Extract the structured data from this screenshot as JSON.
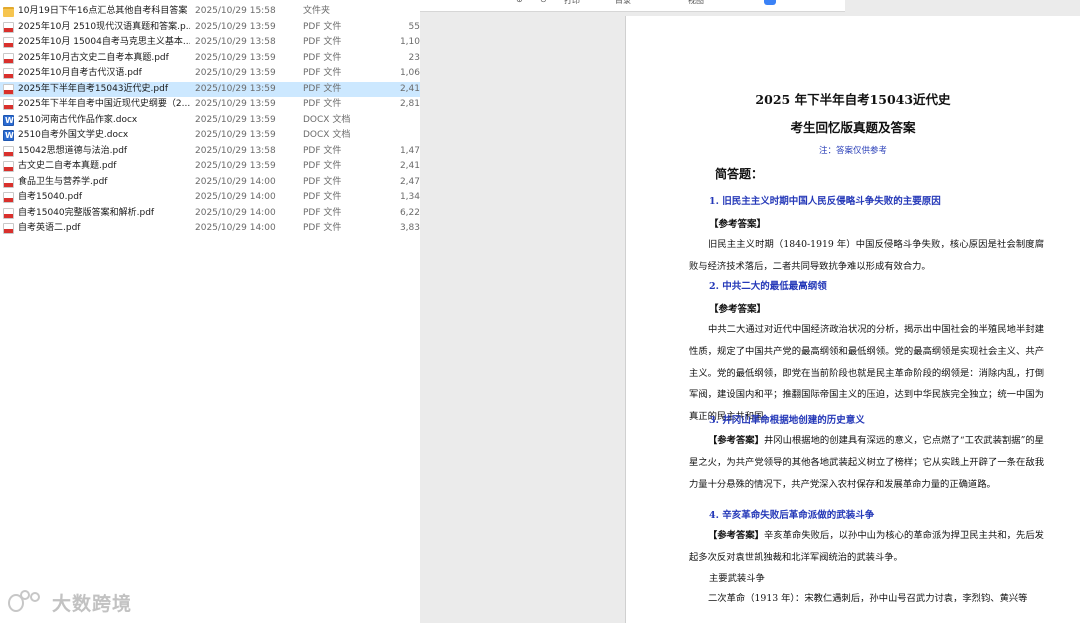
{
  "files": [
    {
      "name": "10月19日下午16点汇总其他自考科目答案",
      "date": "2025/10/29 15:58",
      "type": "文件夹",
      "size": "",
      "icon": "folder-icon"
    },
    {
      "name": "2025年10月 2510现代汉语真题和答案.p...",
      "date": "2025/10/29 13:59",
      "type": "PDF 文件",
      "size": "55",
      "icon": "pdf-icon"
    },
    {
      "name": "2025年10月 15004自考马克思主义基本...",
      "date": "2025/10/29 13:58",
      "type": "PDF 文件",
      "size": "1,10",
      "icon": "pdf-icon"
    },
    {
      "name": "2025年10月古文史二自考本真题.pdf",
      "date": "2025/10/29 13:59",
      "type": "PDF 文件",
      "size": "23",
      "icon": "pdf-icon"
    },
    {
      "name": "2025年10月自考古代汉语.pdf",
      "date": "2025/10/29 13:59",
      "type": "PDF 文件",
      "size": "1,06",
      "icon": "pdf-icon"
    },
    {
      "name": "2025年下半年自考15043近代史.pdf",
      "date": "2025/10/29 13:59",
      "type": "PDF 文件",
      "size": "2,41",
      "icon": "pdf-icon",
      "selected": true
    },
    {
      "name": "2025年下半年自考中国近现代史纲要（2...",
      "date": "2025/10/29 13:59",
      "type": "PDF 文件",
      "size": "2,81",
      "icon": "pdf-icon"
    },
    {
      "name": "2510河南古代作品作家.docx",
      "date": "2025/10/29 13:59",
      "type": "DOCX 文档",
      "size": "",
      "icon": "docx-icon"
    },
    {
      "name": "2510自考外国文学史.docx",
      "date": "2025/10/29 13:59",
      "type": "DOCX 文档",
      "size": "",
      "icon": "docx-icon"
    },
    {
      "name": "15042思想道德与法治.pdf",
      "date": "2025/10/29 13:58",
      "type": "PDF 文件",
      "size": "1,47",
      "icon": "pdf-icon"
    },
    {
      "name": "古文史二自考本真题.pdf",
      "date": "2025/10/29 13:59",
      "type": "PDF 文件",
      "size": "2,41",
      "icon": "pdf-icon"
    },
    {
      "name": "食品卫生与营养学.pdf",
      "date": "2025/10/29 14:00",
      "type": "PDF 文件",
      "size": "2,47",
      "icon": "pdf-icon"
    },
    {
      "name": "自考15040.pdf",
      "date": "2025/10/29 14:00",
      "type": "PDF 文件",
      "size": "1,34",
      "icon": "pdf-icon"
    },
    {
      "name": "自考15040完整版答案和解析.pdf",
      "date": "2025/10/29 14:00",
      "type": "PDF 文件",
      "size": "6,22",
      "icon": "pdf-icon"
    },
    {
      "name": "自考英语二.pdf",
      "date": "2025/10/29 14:00",
      "type": "PDF 文件",
      "size": "3,83",
      "icon": "pdf-icon"
    }
  ],
  "watermark": {
    "text": "大数跨境"
  },
  "toolbar": {
    "items": [
      "打印",
      "目录",
      "视图"
    ]
  },
  "document": {
    "title": "2025 年下半年自考15043近代史",
    "subtitle": "考生回忆版真题及答案",
    "note": "注：答案仅供参考",
    "section": "简答题：",
    "q1": "1. 旧民主主义时期中国人民反侵略斗争失败的主要原因",
    "q1_label": "【参考答案】",
    "q1_answer": "旧民主主义时期（1840-1919 年）中国反侵略斗争失败，核心原因是社会制度腐败与经济技术落后，二者共同导致抗争难以形成有效合力。",
    "q2": "2. 中共二大的最低最高纲领",
    "q2_label": "【参考答案】",
    "q2_answer": "中共二大通过对近代中国经济政治状况的分析，揭示出中国社会的半殖民地半封建性质，规定了中国共产党的最高纲领和最低纲领。党的最高纲领是实现社会主义、共产主义。党的最低纲领，即党在当前阶段也就是民主革命阶段的纲领是：消除内乱，打倒军阀，建设国内和平；推翻国际帝国主义的压迫，达到中华民族完全独立；统一中国为真正的民主共和国。",
    "q3": "3. 井冈山革命根据地创建的历史意义",
    "q3_label": "【参考答案】",
    "q3_answer": "井冈山根据地的创建具有深远的意义，它点燃了“工农武装割据”的星星之火，为共产党领导的其他各地武装起义树立了榜样；它从实践上开辟了一条在敌我力量十分悬殊的情况下，共产党深入农村保存和发展革命力量的正确道路。",
    "q4": "4. 辛亥革命失败后革命派做的武装斗争",
    "q4_label": "【参考答案】",
    "q4_answer": "辛亥革命失败后，以孙中山为核心的革命派为捍卫民主共和，先后发起多次反对袁世凯独裁和北洋军阀统治的武装斗争。",
    "q4_sub": "主要武装斗争",
    "q4_sub_text": "二次革命（1913 年）：宋教仁遇刺后，孙中山号召武力讨袁，李烈钧、黄兴等"
  }
}
